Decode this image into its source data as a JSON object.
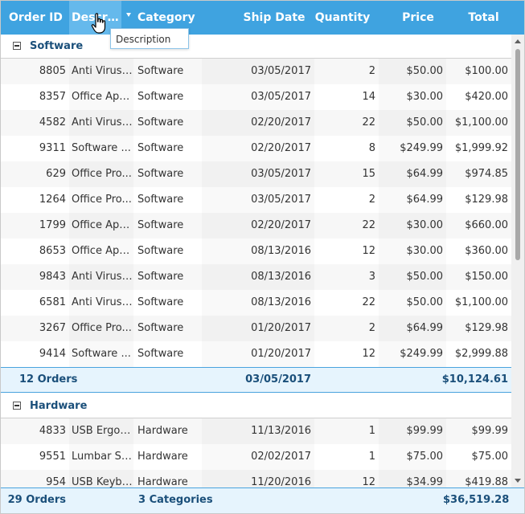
{
  "columns": [
    {
      "key": "order_id",
      "label": "Order ID"
    },
    {
      "key": "description",
      "label": "Descrip..."
    },
    {
      "key": "category",
      "label": "Category"
    },
    {
      "key": "ship_date",
      "label": "Ship Date"
    },
    {
      "key": "quantity",
      "label": "Quantity"
    },
    {
      "key": "price",
      "label": "Price"
    },
    {
      "key": "total",
      "label": "Total"
    }
  ],
  "drag_tooltip": "Description",
  "groups": [
    {
      "name": "Software",
      "rows": [
        {
          "order_id": "8805",
          "description": "Anti Virus ...",
          "category": "Software",
          "ship_date": "03/05/2017",
          "quantity": "2",
          "price": "$50.00",
          "total": "$100.00"
        },
        {
          "order_id": "8357",
          "description": "Office App...",
          "category": "Software",
          "ship_date": "03/05/2017",
          "quantity": "14",
          "price": "$30.00",
          "total": "$420.00"
        },
        {
          "order_id": "4582",
          "description": "Anti Virus ...",
          "category": "Software",
          "ship_date": "02/20/2017",
          "quantity": "22",
          "price": "$50.00",
          "total": "$1,100.00"
        },
        {
          "order_id": "9311",
          "description": "Software ...",
          "category": "Software",
          "ship_date": "02/20/2017",
          "quantity": "8",
          "price": "$249.99",
          "total": "$1,999.92"
        },
        {
          "order_id": "629",
          "description": "Office Pro...",
          "category": "Software",
          "ship_date": "03/05/2017",
          "quantity": "15",
          "price": "$64.99",
          "total": "$974.85"
        },
        {
          "order_id": "1264",
          "description": "Office Pro...",
          "category": "Software",
          "ship_date": "03/05/2017",
          "quantity": "2",
          "price": "$64.99",
          "total": "$129.98"
        },
        {
          "order_id": "1799",
          "description": "Office App...",
          "category": "Software",
          "ship_date": "02/20/2017",
          "quantity": "22",
          "price": "$30.00",
          "total": "$660.00"
        },
        {
          "order_id": "8653",
          "description": "Office App...",
          "category": "Software",
          "ship_date": "08/13/2016",
          "quantity": "12",
          "price": "$30.00",
          "total": "$360.00"
        },
        {
          "order_id": "9843",
          "description": "Anti Virus ...",
          "category": "Software",
          "ship_date": "08/13/2016",
          "quantity": "3",
          "price": "$50.00",
          "total": "$150.00"
        },
        {
          "order_id": "6581",
          "description": "Anti Virus ...",
          "category": "Software",
          "ship_date": "08/13/2016",
          "quantity": "22",
          "price": "$50.00",
          "total": "$1,100.00"
        },
        {
          "order_id": "3267",
          "description": "Office Pro...",
          "category": "Software",
          "ship_date": "01/20/2017",
          "quantity": "2",
          "price": "$64.99",
          "total": "$129.98"
        },
        {
          "order_id": "9414",
          "description": "Software ...",
          "category": "Software",
          "ship_date": "01/20/2017",
          "quantity": "12",
          "price": "$249.99",
          "total": "$2,999.88"
        }
      ],
      "summary": {
        "count": "12 Orders",
        "ship_date": "03/05/2017",
        "total": "$10,124.61"
      }
    },
    {
      "name": "Hardware",
      "rows": [
        {
          "order_id": "4833",
          "description": "USB Ergon...",
          "category": "Hardware",
          "ship_date": "11/13/2016",
          "quantity": "1",
          "price": "$99.99",
          "total": "$99.99"
        },
        {
          "order_id": "9551",
          "description": "Lumbar Su...",
          "category": "Hardware",
          "ship_date": "02/02/2017",
          "quantity": "1",
          "price": "$75.00",
          "total": "$75.00"
        },
        {
          "order_id": "954",
          "description": "USB Keybo...",
          "category": "Hardware",
          "ship_date": "11/20/2016",
          "quantity": "12",
          "price": "$34.99",
          "total": "$419.88"
        }
      ]
    }
  ],
  "footer": {
    "count": "29 Orders",
    "categories": "3 Categories",
    "total": "$36,519.28"
  },
  "icons": {
    "collapse": "collapse-minus-icon",
    "filter": "filter-arrow-icon",
    "cursor": "hand-cursor-icon"
  },
  "colors": {
    "header_bg": "#3fa3e0",
    "summary_bg": "#e6f4fd",
    "accent": "#4aa3de",
    "group_text": "#1a4f7a"
  }
}
